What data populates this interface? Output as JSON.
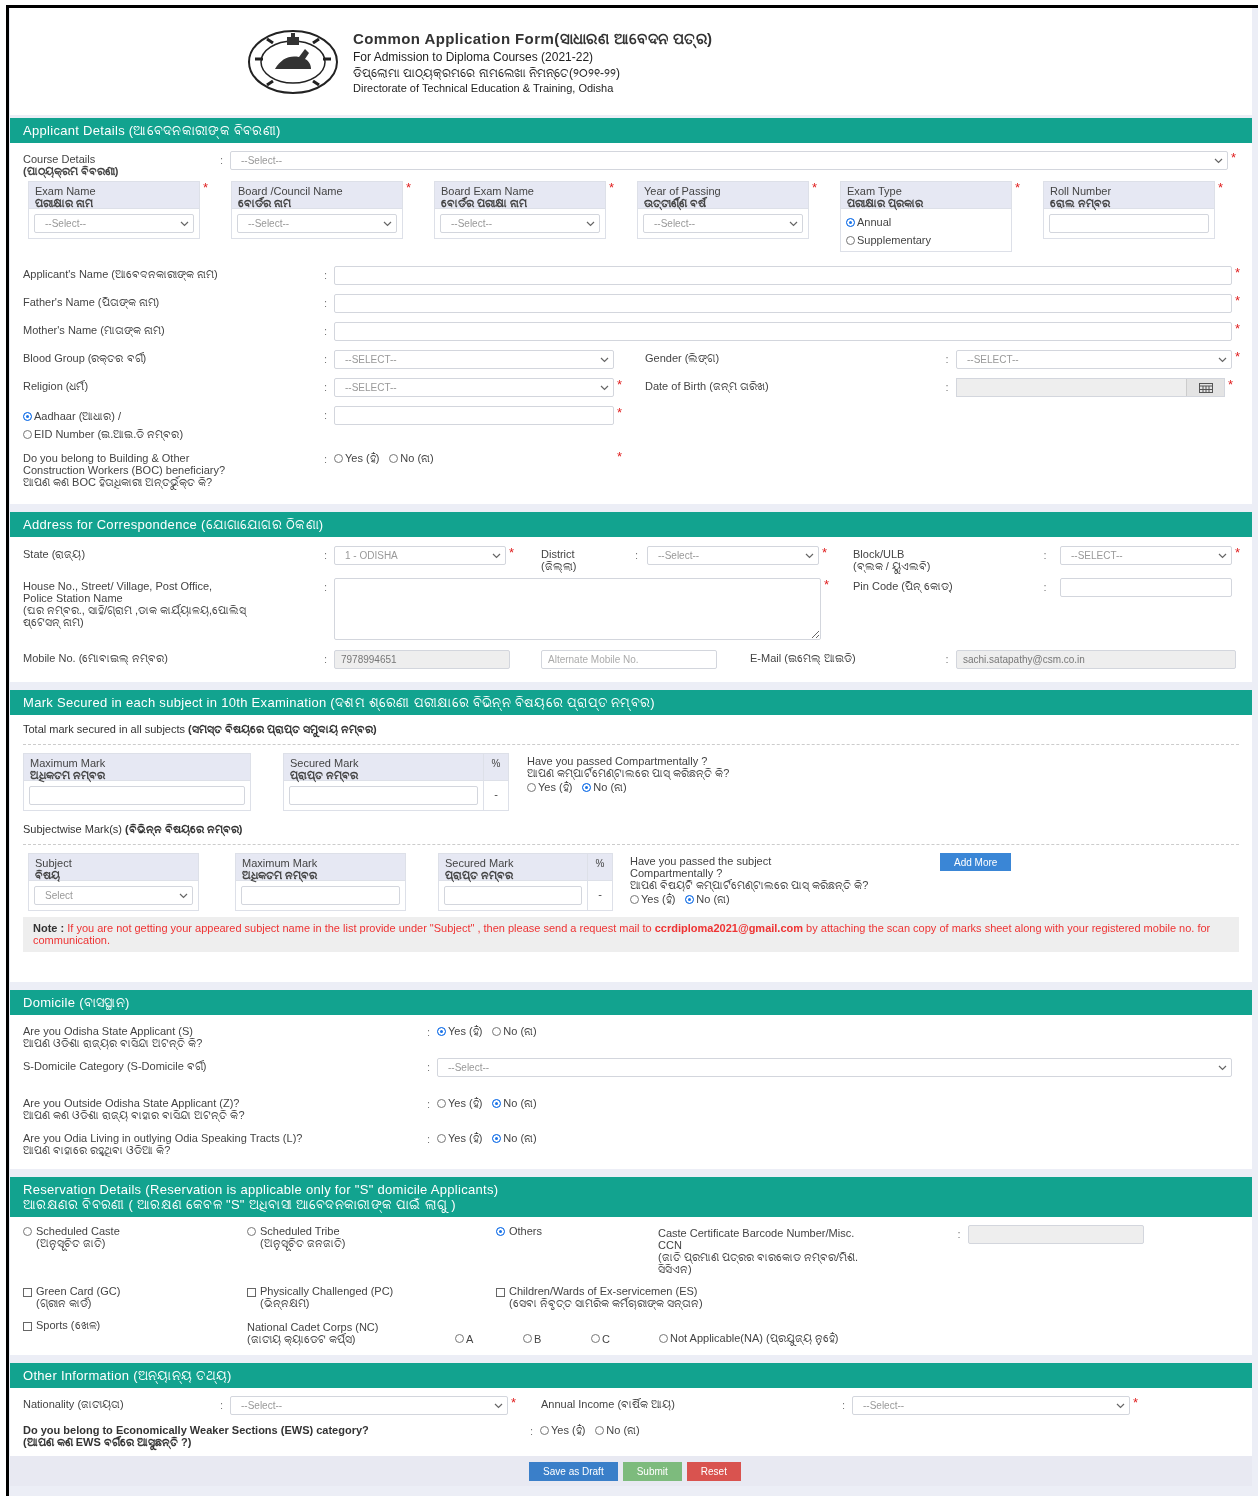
{
  "separator": ":",
  "required_mark": "*",
  "header": {
    "title": "Common Application Form(ସାଧାରଣ ଆବେଦନ ପତ୍ର)",
    "subtitle": "For Admission to Diploma Courses (2021-22)",
    "subtitle_or": "ଡିପ୍ଲୋମା ପାଠ୍ୟକ୍ରମରେ ନାମଲେଖା ନିମନ୍ତେ(୨୦୨୧-୨୨)",
    "department": "Directorate of Technical Education & Training, Odisha"
  },
  "applicant": {
    "heading": "Applicant Details (ଆବେଦନକାରୀଙ୍କ ବିବରଣୀ)",
    "course": {
      "label": [
        "Course Details",
        "**(ପାଠ୍ୟକ୍ରମ ବିବରଣୀ)**"
      ],
      "control": {
        "kind": "select",
        "value": "--Select--"
      },
      "required": true
    },
    "exam_fields": [
      {
        "label": [
          "Exam Name",
          "**ପରୀକ୍ଷାର ନାମ**"
        ],
        "control": {
          "kind": "select",
          "value": "--Select--"
        },
        "required": true
      },
      {
        "label": [
          "Board /Council Name",
          "**ବୋର୍ଡର ନାମ**"
        ],
        "control": {
          "kind": "select",
          "value": "--Select--"
        },
        "required": true
      },
      {
        "label": [
          "Board Exam Name",
          "**ବୋର୍ଡର ପରୀକ୍ଷା ନାମ**"
        ],
        "control": {
          "kind": "select",
          "value": "--Select--"
        },
        "required": true
      },
      {
        "label": [
          "Year of Passing",
          "**ଉତ୍ତୀର୍ଣ୍ଣ ବର୍ଷ**"
        ],
        "control": {
          "kind": "select",
          "value": "--Select--"
        },
        "required": true
      },
      {
        "label": [
          "Exam Type",
          "**ପରୀକ୍ଷାର ପ୍ରକାର**"
        ],
        "control": {
          "kind": "radios",
          "options": [
            {
              "label": "Annual",
              "selected": true
            },
            {
              "label": "Supplementary",
              "selected": false
            }
          ]
        },
        "required": true
      },
      {
        "label": [
          "Roll Number",
          "**ରୋଲ ନମ୍ବର**"
        ],
        "control": {
          "kind": "text"
        },
        "required": true
      }
    ],
    "names": [
      {
        "label": [
          "Applicant's Name (ଆବେଦନକାରୀଙ୍କ ନାମ)"
        ],
        "control": {
          "kind": "text"
        },
        "required": true
      },
      {
        "label": [
          "Father's Name (ପିତାଙ୍କ ନାମ)"
        ],
        "control": {
          "kind": "text"
        },
        "required": true
      },
      {
        "label": [
          "Mother's Name (ମାତାଙ୍କ ନାମ)"
        ],
        "control": {
          "kind": "text"
        },
        "required": true
      }
    ],
    "pairs": [
      [
        {
          "label": [
            "Blood Group (ରକ୍ତର ବର୍ଗ)"
          ],
          "control": {
            "kind": "select",
            "value": "--SELECT--"
          }
        },
        {
          "label": [
            "Gender (ଲିଙ୍ଗ)"
          ],
          "control": {
            "kind": "select",
            "value": "--SELECT--"
          },
          "required": true
        }
      ],
      [
        {
          "label": [
            "Religion (ଧର୍ମ)"
          ],
          "control": {
            "kind": "select",
            "value": "--SELECT--"
          },
          "required": true
        },
        {
          "label": [
            "Date of Birth (ଜନ୍ମ ତାରିଖ)"
          ],
          "control": {
            "kind": "date"
          },
          "required": true
        }
      ]
    ],
    "id_field": {
      "options": [
        {
          "label": "Aadhaar (ଆଧାର) /",
          "selected": true
        },
        {
          "label": "EID Number (ଇ.ଆଇ.ଡି ନମ୍ବର)",
          "selected": false
        }
      ],
      "control": {
        "kind": "text"
      },
      "required": true
    },
    "boc": {
      "label": [
        "Do you belong to Building & Other",
        "Construction Workers (BOC) beneficiary?",
        "ଆପଣ କଣ BOC ହିତାଧିକାରୀ ଅନ୍ତର୍ଭୁକ୍ତ କି?"
      ],
      "control": {
        "kind": "radios",
        "options": [
          {
            "label": "Yes (ହଁ)",
            "selected": false
          },
          {
            "label": "No (ନା)",
            "selected": false
          }
        ]
      },
      "required": true
    }
  },
  "address": {
    "heading": "Address for Correspondence (ଯୋଗାଯୋଗର ଠିକଣା)",
    "state": {
      "label": [
        "State (ରାଜ୍ୟ)"
      ],
      "control": {
        "kind": "select",
        "value": "1 - ODISHA"
      },
      "required": true
    },
    "district": {
      "label": [
        "District",
        "(ଜିଲ୍ଲା)"
      ],
      "control": {
        "kind": "select",
        "value": "--Select--"
      },
      "required": true
    },
    "block": {
      "label": [
        "Block/ULB",
        "(ବ୍ଲକ / ୟୁଏଲବି)"
      ],
      "control": {
        "kind": "select",
        "value": "--SELECT--"
      },
      "required": true
    },
    "house": {
      "label": [
        "House No., Street/ Village, Post Office,",
        "Police Station Name",
        "(ଘର ନମ୍ବର., ସାହି/ଗ୍ରାମ ,ଡାକ କାର୍ଯ୍ୟାଳୟ,ପୋଲିସ୍",
        "ଷ୍ଟେସନ୍ ନାମ)"
      ],
      "control": {
        "kind": "textarea"
      },
      "required": true
    },
    "pin": {
      "label": [
        "Pin Code (ପିନ୍ କୋଡ୍)"
      ],
      "control": {
        "kind": "text"
      }
    },
    "mobile": {
      "label": [
        "Mobile No. (ମୋବାଇଲ୍ ନମ୍ବର)"
      ],
      "control": {
        "kind": "text",
        "value": "7978994651",
        "disabled": true
      }
    },
    "alternate": {
      "control": {
        "kind": "text",
        "placeholder": "Alternate Mobile No."
      }
    },
    "email": {
      "label": [
        "E-Mail (ଇମେଲ୍ ଆଇଡି)"
      ],
      "control": {
        "kind": "text",
        "value": "sachi.satapathy@csm.co.in",
        "disabled": true
      }
    }
  },
  "marks": {
    "heading": "Mark Secured in each subject in 10th Examination (ଦଶମ ଶ୍ରେଣୀ ପରୀକ୍ଷାରେ ବିଭିନ୍ନ ବିଷୟରେ ପ୍ରାପ୍ତ ନମ୍ବର)",
    "total": {
      "title": "Total mark secured in all subjects **(ସମସ୍ତ ବିଷୟରେ ପ୍ରାପ୍ତ ସମୁଦାୟ ନମ୍ବର)**",
      "max": {
        "label": [
          "Maximum Mark",
          "**ଅଧିକତମ ନମ୍ବର**"
        ]
      },
      "secured": {
        "label": [
          "Secured Mark",
          "**ପ୍ରାପ୍ତ ନମ୍ବର**"
        ],
        "percent_label": "%",
        "percent": "-"
      },
      "question": {
        "label": [
          "Have you passed Compartmentally ?",
          "ଆପଣ କମ୍ପାର୍ଟମେଣ୍ଟାଲରେ ପାସ୍ କରିଛନ୍ତି କି?"
        ],
        "control": {
          "kind": "radios",
          "options": [
            {
              "label": "Yes (ହଁ)",
              "selected": false
            },
            {
              "label": "No (ନା)",
              "selected": true
            }
          ]
        }
      }
    },
    "subjectwise": {
      "title": "Subjectwise Mark(s) **(ବିଭିନ୍ନ ବିଷୟରେ ନମ୍ବର)**",
      "subject": {
        "label": [
          "Subject",
          "**ବିଷୟ**"
        ],
        "control": {
          "kind": "select",
          "value": "Select"
        }
      },
      "max": {
        "label": [
          "Maximum Mark",
          "**ଅଧିକତମ ନମ୍ବର**"
        ]
      },
      "secured": {
        "label": [
          "Secured Mark",
          "**ପ୍ରାପ୍ତ ନମ୍ବର**"
        ],
        "percent_label": "%",
        "percent": "-"
      },
      "question": {
        "label": [
          "Have you passed the subject",
          "Compartmentally ?",
          "ଆପଣ ବିଷୟଟି କମ୍ପାର୍ଟମେଣ୍ଟାଲରେ ପାସ୍ କରିଛନ୍ତି କି?"
        ],
        "control": {
          "kind": "radios",
          "options": [
            {
              "label": "Yes (ହଁ)",
              "selected": false
            },
            {
              "label": "No (ନା)",
              "selected": true
            }
          ]
        }
      },
      "add_button": "Add More"
    },
    "note": {
      "label": "Note :",
      "text": "If you are not getting your appeared subject name in the list provide under \"Subject\" , then please send a request mail to **ccrdiploma2021@gmail.com** by attaching the scan copy of marks sheet along with your registered mobile no. for communication."
    }
  },
  "domicile": {
    "heading": "Domicile (ବାସସ୍ଥାନ)",
    "rows": [
      {
        "label": [
          "Are you Odisha State Applicant (S)",
          "ଆପଣ ଓଡିଶା ରାଜ୍ୟର ବାସିନ୍ଦା ଅଟନ୍ତି କି?"
        ],
        "control": {
          "kind": "radios",
          "options": [
            {
              "label": "Yes (ହଁ)",
              "selected": true
            },
            {
              "label": "No (ନା)",
              "selected": false
            }
          ]
        }
      },
      {
        "label": [
          "S-Domicile Category (S-Domicile ବର୍ଗ)"
        ],
        "control": {
          "kind": "select",
          "value": "--Select--"
        }
      },
      {
        "label": [
          "Are you Outside Odisha State Applicant (Z)?",
          "ଆପଣ କଣ ଓଡିଶା ରାଜ୍ୟ ବାହାର ବାସିନ୍ଦା ଅଟନ୍ତି କି?"
        ],
        "control": {
          "kind": "radios",
          "options": [
            {
              "label": "Yes (ହଁ)",
              "selected": false
            },
            {
              "label": "No (ନା)",
              "selected": true
            }
          ]
        }
      },
      {
        "label": [
          "Are you Odia Living in outlying Odia Speaking Tracts (L)?",
          "ଆପଣ ବାହାରେ ରହୁଥିବା ଓଡିଆ କି?"
        ],
        "control": {
          "kind": "radios",
          "options": [
            {
              "label": "Yes (ହଁ)",
              "selected": false
            },
            {
              "label": "No (ନା)",
              "selected": true
            }
          ]
        }
      }
    ]
  },
  "reservation": {
    "heading": [
      "Reservation Details (Reservation is applicable only for \"S\" domicile Applicants)",
      "ଆରକ୍ଷଣର ବିବରଣୀ ( ଆରକ୍ଷଣ କେବଳ \"S\" ଅଧିବାସୀ ଆବେଦନକାରୀଙ୍କ ପାଇଁ ଲାଗୁ )"
    ],
    "categories": [
      {
        "label": [
          "Scheduled Caste",
          "(ଅନୁସୂଚିତ ଜାତି)"
        ],
        "selected": false
      },
      {
        "label": [
          "Scheduled Tribe",
          "(ଅନୁସୂଚିତ ଜନଜାତି)"
        ],
        "selected": false
      },
      {
        "label": [
          "Others"
        ],
        "selected": true
      }
    ],
    "caste_certificate": {
      "label": [
        "Caste Certificate Barcode Number/Misc.",
        "CCN",
        "(ଜାତି ପ୍ରମାଣ ପତ୍ରର ବାରକୋଡ ନମ୍ବର/ମିଶ.",
        "ସିସିଏନ)"
      ],
      "control": {
        "kind": "text",
        "disabled": true
      }
    },
    "special": [
      {
        "label": [
          "Green Card (GC)",
          "(ଗ୍ରୀନ କାର୍ଡ)"
        ],
        "checked": false
      },
      {
        "label": [
          "Physically Challenged (PC)",
          "(ଭିନ୍ନକ୍ଷମ)"
        ],
        "checked": false
      },
      {
        "label": [
          "Children/Wards of Ex-servicemen (ES)",
          "(ସେବା ନିବୃତ୍ତ ସାମରିକ କର୍ମଚାରୀଙ୍କ ସନ୍ତାନ)"
        ],
        "checked": false
      },
      {
        "label": [
          "Sports (ଖେଳ)"
        ],
        "checked": false
      }
    ],
    "ncc": {
      "label": [
        "National Cadet Corps (NC)",
        "(ଜାତୀୟ କ୍ୟାଡେଟ କର୍ପ୍ସ)"
      ],
      "options": [
        {
          "label": "A",
          "selected": false
        },
        {
          "label": "B",
          "selected": false
        },
        {
          "label": "C",
          "selected": false
        },
        {
          "label": "Not Applicable(NA) (ପ୍ରଯୁଜ୍ୟ ନୁହେଁ)",
          "selected": false
        }
      ]
    }
  },
  "other": {
    "heading": "Other Information (ଅନ୍ୟାନ୍ୟ ତଥ୍ୟ)",
    "nationality": {
      "label": [
        "Nationality (ଜାତୀୟତା)"
      ],
      "control": {
        "kind": "select",
        "value": "--Select--"
      },
      "required": true
    },
    "income": {
      "label": [
        "Annual Income (ବାର୍ଷିକ ଆୟ)"
      ],
      "control": {
        "kind": "select",
        "value": "--Select--"
      },
      "required": true
    },
    "ews": {
      "label": [
        "Do you belong to Economically Weaker Sections (EWS) category?",
        "(ଆପଣ କଣ EWS ବର୍ଗରେ ଆସୁଛନ୍ତି ?)"
      ],
      "control": {
        "kind": "radios",
        "options": [
          {
            "label": "Yes (ହଁ)",
            "selected": false
          },
          {
            "label": "No (ନା)",
            "selected": false
          }
        ]
      }
    }
  },
  "buttons": [
    {
      "label": "Save as Draft",
      "kind": "draft"
    },
    {
      "label": "Submit",
      "kind": "submit"
    },
    {
      "label": "Reset",
      "kind": "reset"
    }
  ]
}
